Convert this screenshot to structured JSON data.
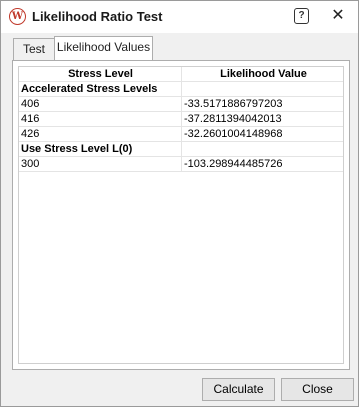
{
  "window": {
    "title": "Likelihood Ratio Test",
    "app_icon_letter": "W",
    "help_glyph": "?",
    "close_glyph": "✕"
  },
  "tabs": [
    {
      "label": "Test",
      "active": false
    },
    {
      "label": "Likelihood Values",
      "active": true
    }
  ],
  "table": {
    "columns": [
      "Stress Level",
      "Likelihood Value"
    ],
    "rows": [
      {
        "type": "group",
        "stress": "Accelerated Stress Levels",
        "value": ""
      },
      {
        "type": "data",
        "stress": "406",
        "value": "-33.5171886797203"
      },
      {
        "type": "data",
        "stress": "416",
        "value": "-37.2811394042013"
      },
      {
        "type": "data",
        "stress": "426",
        "value": "-32.2601004148968"
      },
      {
        "type": "group",
        "stress": "Use Stress Level L(0)",
        "value": ""
      },
      {
        "type": "data",
        "stress": "300",
        "value": "-103.298944485726"
      }
    ]
  },
  "buttons": {
    "calculate": "Calculate",
    "close": "Close"
  }
}
